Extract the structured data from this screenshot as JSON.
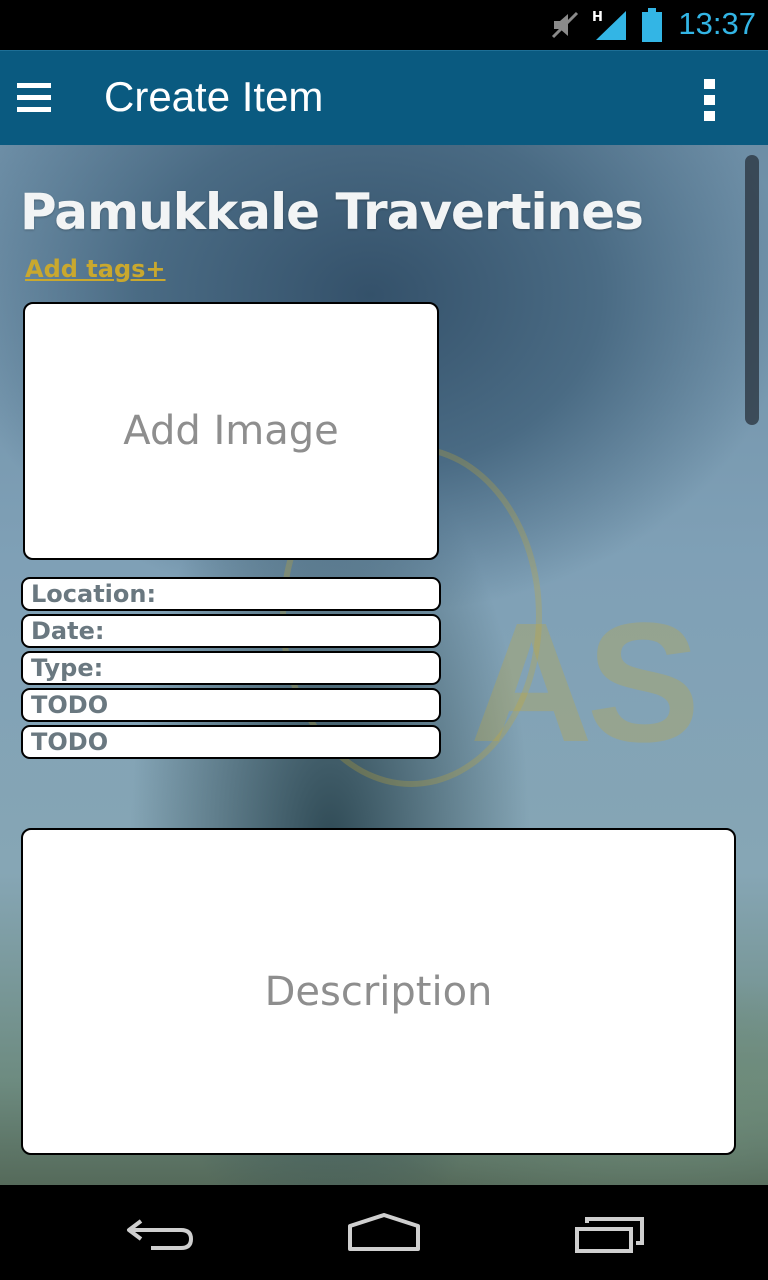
{
  "status_bar": {
    "time": "13:37",
    "icons": [
      "mute-icon",
      "signal-icon",
      "battery-icon"
    ],
    "signal_label": "H",
    "accent_color": "#33b5e5"
  },
  "action_bar": {
    "title": "Create Item",
    "background_color": "#0a5a80",
    "icons": [
      "menu-icon",
      "overflow-menu-icon"
    ]
  },
  "item": {
    "title": "Pamukkale Travertines",
    "add_tags_label": "Add tags+",
    "add_image_label": "Add Image",
    "fields": [
      {
        "label": "Location:"
      },
      {
        "label": "Date:"
      },
      {
        "label": "Type:"
      },
      {
        "label": "TODO"
      },
      {
        "label": "TODO"
      }
    ],
    "description_placeholder": "Description"
  },
  "navigation_bar": {
    "icons": [
      "back-icon",
      "home-icon",
      "recent-apps-icon"
    ]
  }
}
